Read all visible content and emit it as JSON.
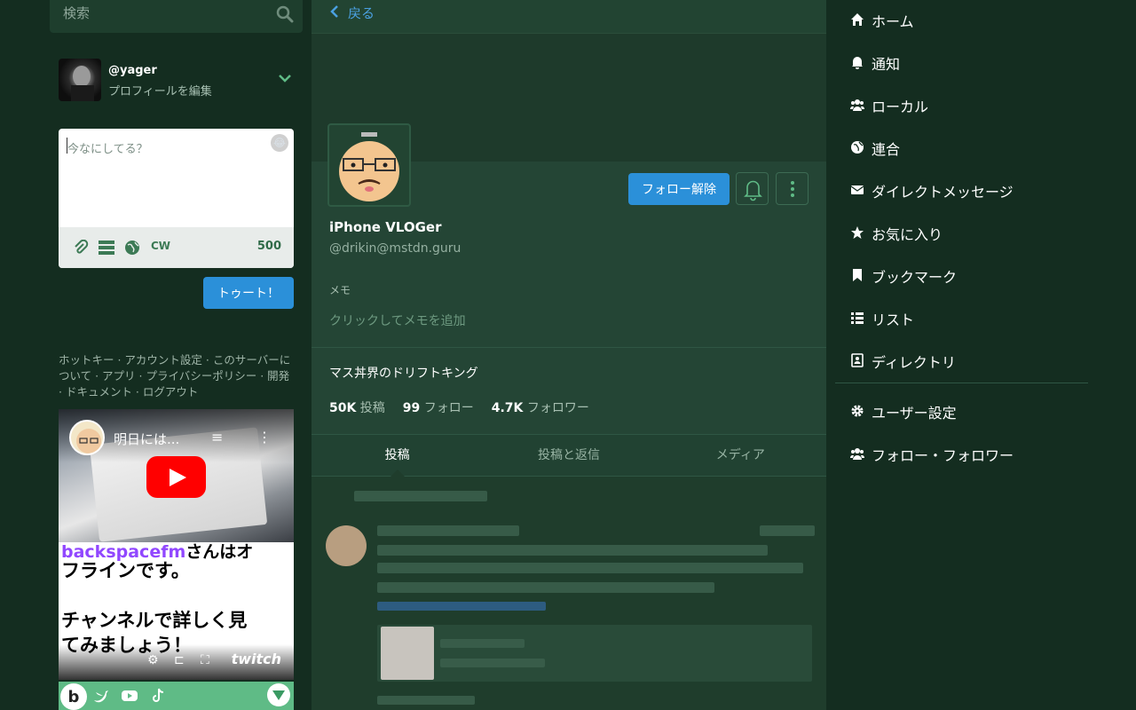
{
  "search": {
    "placeholder": "検索"
  },
  "account": {
    "handle": "@yager",
    "edit_label": "プロフィールを編集"
  },
  "compose": {
    "placeholder": "今なにしてる？",
    "cw_label": "CW",
    "char_count": "500",
    "submit_label": "トゥート！"
  },
  "links_text": "ホットキー · アカウント設定 · このサーバーについて · アプリ · プライバシーポリシー · 開発 · ドキュメント · ログアウト",
  "video": {
    "title": "明日には..."
  },
  "twitch": {
    "line1_a": "backspacefm",
    "line1_b": "さんはオ",
    "body": "フラインです。\n\nチャンネルで詳しく見\nてみましょう！",
    "logo": "twitch"
  },
  "social": {
    "b_label": "b"
  },
  "column": {
    "back_label": "戻る"
  },
  "profile": {
    "unfollow_label": "フォロー解除",
    "display_name": "iPhone VLOGer",
    "acct": "@drikin@mstdn.guru",
    "memo_label": "メモ",
    "memo_add": "クリックしてメモを追加",
    "bio": "マス丼界のドリフトキング",
    "stats": {
      "posts_value": "50K",
      "posts_label": "投稿",
      "following_value": "99",
      "following_label": "フォロー",
      "followers_value": "4.7K",
      "followers_label": "フォロワー"
    },
    "tabs": [
      "投稿",
      "投稿と返信",
      "メディア"
    ]
  },
  "nav": {
    "items": [
      {
        "label": "ホーム",
        "icon": "home-icon"
      },
      {
        "label": "通知",
        "icon": "bell-icon"
      },
      {
        "label": "ローカル",
        "icon": "users-icon"
      },
      {
        "label": "連合",
        "icon": "globe-icon"
      },
      {
        "label": "ダイレクトメッセージ",
        "icon": "envelope-icon"
      },
      {
        "label": "お気に入り",
        "icon": "star-icon"
      },
      {
        "label": "ブックマーク",
        "icon": "bookmark-icon"
      },
      {
        "label": "リスト",
        "icon": "list-icon"
      },
      {
        "label": "ディレクトリ",
        "icon": "address-book-icon"
      }
    ],
    "bottom": [
      {
        "label": "ユーザー設定",
        "icon": "gear-icon"
      },
      {
        "label": "フォロー・フォロワー",
        "icon": "users-icon"
      }
    ]
  },
  "colors": {
    "accent": "#2b90d9",
    "background": "#142d20",
    "column": "#1f3d2c",
    "social_bar": "#5fbb86"
  }
}
